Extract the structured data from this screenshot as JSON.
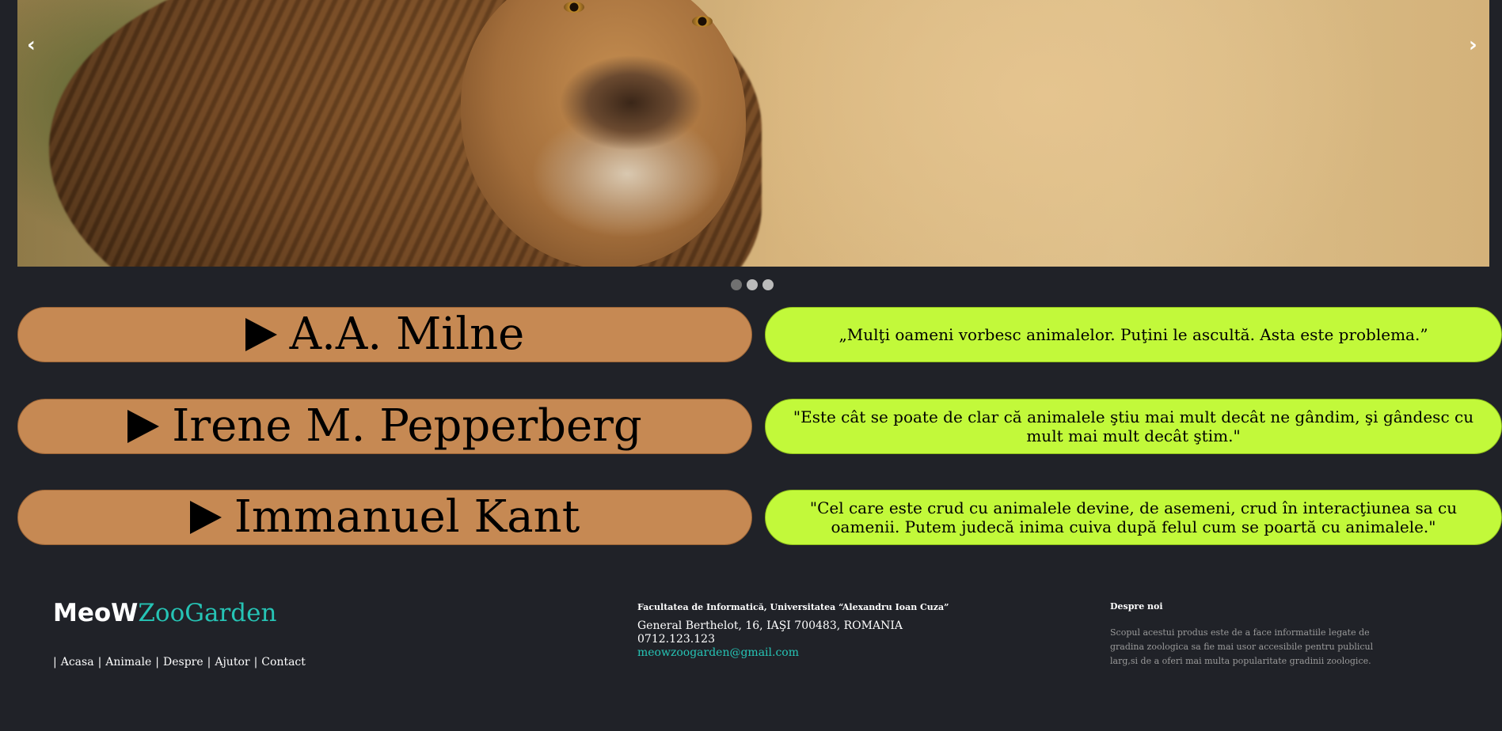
{
  "slider": {
    "prev_label": "‹",
    "next_label": "›",
    "dots": 3,
    "active_dot": 0
  },
  "quotes": [
    {
      "author": "A.A. Milne",
      "text": "„Mulţi oameni vorbesc animalelor. Puţini le ascultă. Asta este problema.”"
    },
    {
      "author": "Irene M. Pepperberg",
      "text": "\"Este cât se poate de clar că animalele ştiu mai mult decât ne gândim, şi gândesc cu mult mai mult decât ştim.\""
    },
    {
      "author": "Immanuel Kant",
      "text": "\"Cel care este crud cu animalele devine, de asemeni, crud în interacţiunea sa cu oamenii. Putem judecă inima cuiva după felul cum se poartă cu animalele.\""
    }
  ],
  "colors": {
    "background": "#202228",
    "author_bg": "#c68953",
    "quote_bg": "#c2f93a",
    "accent": "#26c4b5"
  },
  "footer": {
    "logo_part1": "MeoW",
    "logo_part2": "ZooGarden",
    "nav": [
      "Acasa",
      "Animale",
      "Despre",
      "Ajutor",
      "Contact"
    ],
    "nav_separator": "|",
    "contact": {
      "title": "Facultatea de Informatică, Universitatea “Alexandru Ioan Cuza”",
      "address": "General Berthelot, 16, IAŞI 700483, ROMANIA",
      "phone": "0712.123.123",
      "email": "meowzoogarden@gmail.com"
    },
    "about": {
      "title": "Despre noi",
      "text": "Scopul acestui produs este de a face informatiile legate de gradina zoologica sa fie mai usor accesibile pentru publicul larg,si de a oferi mai multa popularitate gradinii zoologice."
    }
  }
}
